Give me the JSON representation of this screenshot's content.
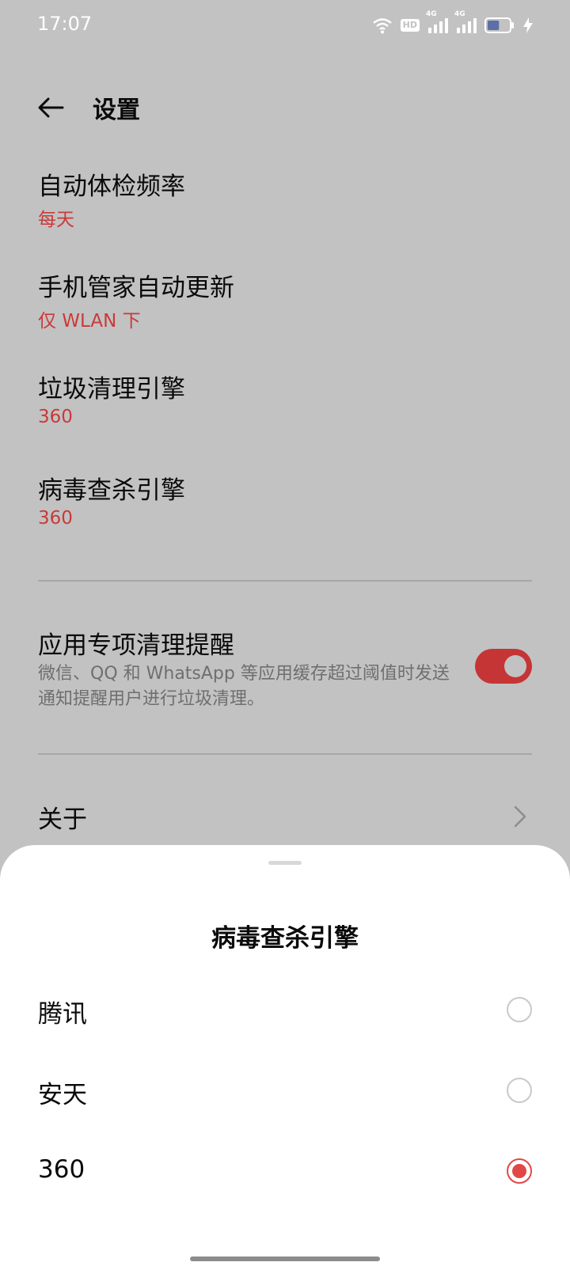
{
  "status_bar": {
    "time": "17:07",
    "hd_label": "HD",
    "net1": "4G",
    "net2": "4G",
    "icons": [
      "wifi-icon",
      "hd-icon",
      "signal-icon",
      "signal-icon",
      "battery-icon",
      "charging-icon"
    ],
    "battery_level": 0.55
  },
  "header": {
    "title": "设置"
  },
  "settings": {
    "items": [
      {
        "title": "自动体检频率",
        "value": "每天"
      },
      {
        "title": "手机管家自动更新",
        "value": "仅 WLAN 下"
      },
      {
        "title": "垃圾清理引擎",
        "value": "360"
      },
      {
        "title": "病毒查杀引擎",
        "value": "360"
      }
    ],
    "reminder": {
      "title": "应用专项清理提醒",
      "description": "微信、QQ 和 WhatsApp 等应用缓存超过阈值时发送通知提醒用户进行垃圾清理。",
      "enabled": true
    },
    "about": {
      "title": "关于"
    }
  },
  "sheet": {
    "title": "病毒查杀引擎",
    "options": [
      {
        "label": "腾讯",
        "selected": false
      },
      {
        "label": "安天",
        "selected": false
      },
      {
        "label": "360",
        "selected": true
      }
    ]
  },
  "colors": {
    "accent": "#c93a3a",
    "radio_selected": "#e04848",
    "scrim_background": "#c2c2c2",
    "sheet_background": "#ffffff"
  }
}
